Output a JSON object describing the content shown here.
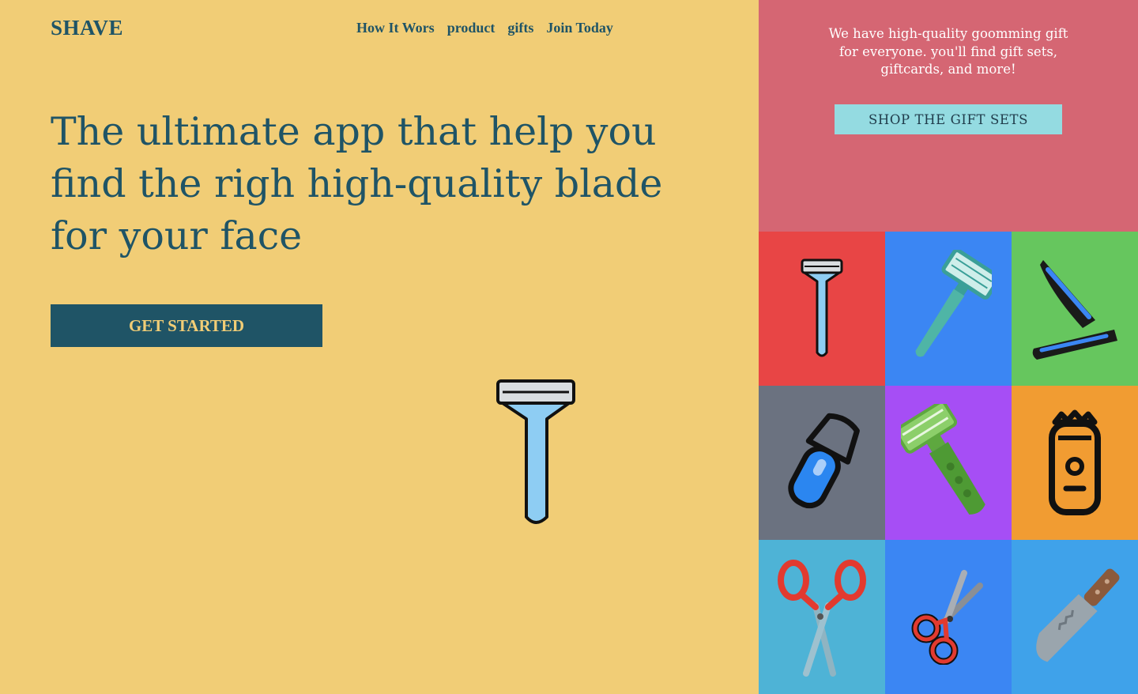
{
  "header": {
    "logo": "SHAVE",
    "nav": [
      "How It Wors",
      "product",
      "gifts",
      "Join Today"
    ]
  },
  "hero": {
    "headline": "The ultimate app that help you find the righ high-quality blade for your face",
    "cta_label": "GET STARTED",
    "image_icon": "safety-razor-icon"
  },
  "promo": {
    "text": "We have high-quality goomming gift for everyone. you'll find gift sets, giftcards, and more!",
    "button_label": "SHOP THE GIFT SETS"
  },
  "products": [
    {
      "icon": "safety-razor-icon",
      "tile_color": "#e84545"
    },
    {
      "icon": "cartridge-razor-icon",
      "tile_color": "#3b86f3"
    },
    {
      "icon": "straight-razor-icon",
      "tile_color": "#66c65e"
    },
    {
      "icon": "electric-shaver-icon",
      "tile_color": "#6b7280"
    },
    {
      "icon": "disposable-razor-icon",
      "tile_color": "#a64ef5"
    },
    {
      "icon": "foil-shaver-icon",
      "tile_color": "#f19c32"
    },
    {
      "icon": "scissors-icon",
      "tile_color": "#4eb3d6"
    },
    {
      "icon": "small-scissors-icon",
      "tile_color": "#3b86f3"
    },
    {
      "icon": "knife-icon",
      "tile_color": "#3fa2ea"
    }
  ],
  "colors": {
    "left_bg": "#f1cd76",
    "accent": "#1f5466",
    "promo_bg": "#d56673",
    "promo_button": "#94dbe1"
  }
}
